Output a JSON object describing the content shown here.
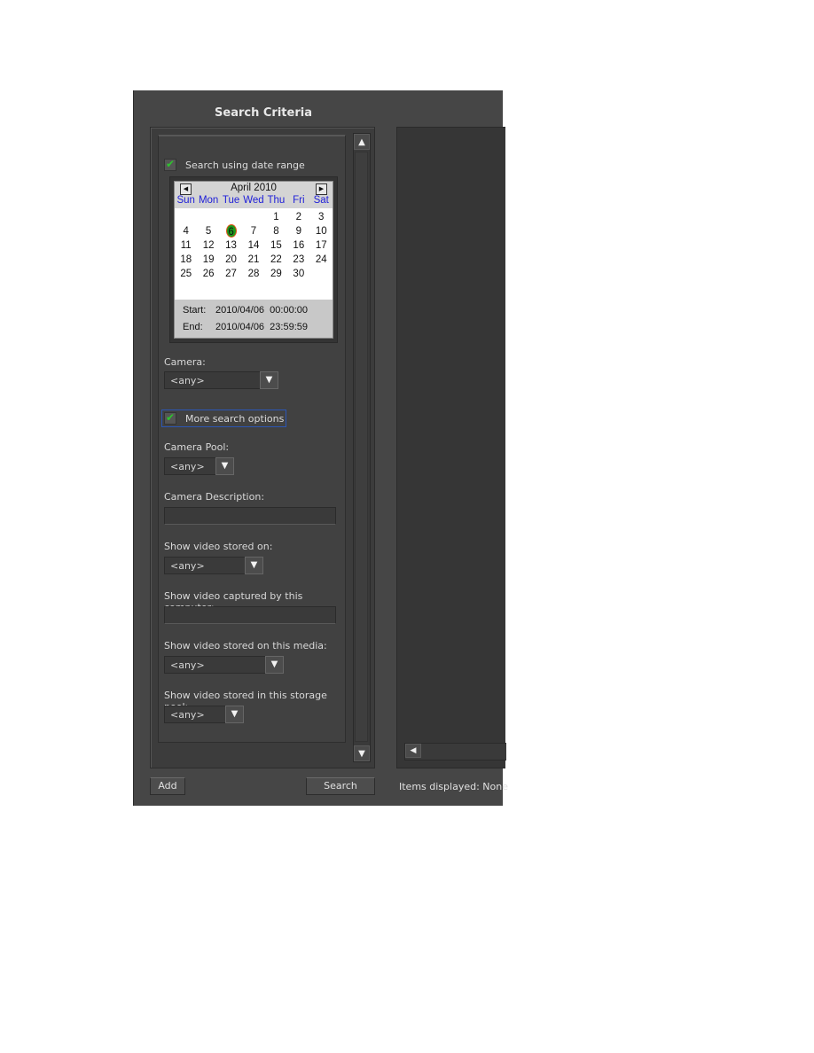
{
  "panel": {
    "title": "Search Criteria"
  },
  "date_range": {
    "checkbox_label": "Search using date range",
    "checked": true
  },
  "calendar": {
    "month_label": "April 2010",
    "prev_icon": "triangle-left-icon",
    "next_icon": "triangle-right-icon",
    "weekdays": [
      "Sun",
      "Mon",
      "Tue",
      "Wed",
      "Thu",
      "Fri",
      "Sat"
    ],
    "weeks": [
      [
        "",
        "",
        "",
        "",
        "1",
        "2",
        "3"
      ],
      [
        "4",
        "5",
        "6",
        "7",
        "8",
        "9",
        "10"
      ],
      [
        "11",
        "12",
        "13",
        "14",
        "15",
        "16",
        "17"
      ],
      [
        "18",
        "19",
        "20",
        "21",
        "22",
        "23",
        "24"
      ],
      [
        "25",
        "26",
        "27",
        "28",
        "29",
        "30",
        ""
      ]
    ],
    "selected_day": "6",
    "start_label": "Start:",
    "start_value": "2010/04/06  00:00:00",
    "end_label": "End:",
    "end_value": "2010/04/06  23:59:59"
  },
  "fields": {
    "camera_label": "Camera:",
    "camera_value": "<any>",
    "more_options_label": "More search options",
    "more_options_checked": true,
    "camera_pool_label": "Camera Pool:",
    "camera_pool_value": "<any>",
    "camera_description_label": "Camera Description:",
    "camera_description_value": "",
    "stored_on_label": "Show video stored on:",
    "stored_on_value": "<any>",
    "captured_by_label": "Show video captured by this computer:",
    "captured_by_value": "",
    "media_label": "Show video stored on this media:",
    "media_value": "<any>",
    "storage_pool_label": "Show video stored in this storage pool:",
    "storage_pool_value": "<any>"
  },
  "icons": {
    "dropdown": "▼",
    "scroll_up": "▲",
    "scroll_down": "▼",
    "scroll_left": "◀",
    "check": "✔",
    "prev": "◀",
    "next": "▶"
  },
  "footer": {
    "add_label": "Add",
    "search_label": "Search",
    "status_text": "Items displayed: None"
  }
}
